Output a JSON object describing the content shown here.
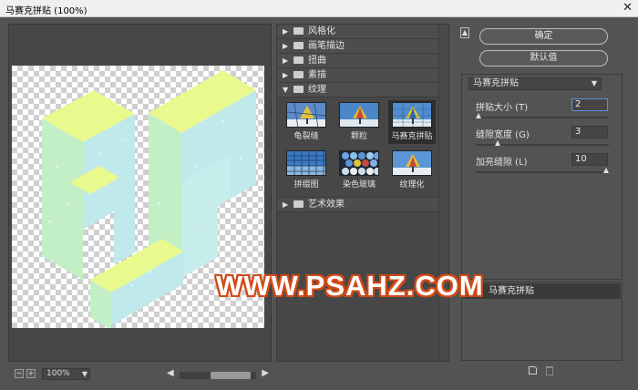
{
  "window": {
    "title": "马赛克拼贴 (100%)",
    "close_glyph": "✕"
  },
  "preview": {
    "zoom_value": "100%",
    "zoom_minus": "−",
    "zoom_plus": "+"
  },
  "gallery": {
    "categories": [
      {
        "label": "风格化",
        "expanded": false
      },
      {
        "label": "画笔描边",
        "expanded": false
      },
      {
        "label": "扭曲",
        "expanded": false
      },
      {
        "label": "素描",
        "expanded": false
      },
      {
        "label": "纹理",
        "expanded": true
      },
      {
        "label": "艺术效果",
        "expanded": false
      }
    ],
    "texture_thumbs": [
      {
        "label": "龟裂缝",
        "icon": "craquelure-thumbnail"
      },
      {
        "label": "颗粒",
        "icon": "grain-thumbnail"
      },
      {
        "label": "马赛克拼贴",
        "icon": "mosaic-tiles-thumbnail",
        "selected": true
      },
      {
        "label": "拼缀图",
        "icon": "patchwork-thumbnail"
      },
      {
        "label": "染色玻璃",
        "icon": "stained-glass-thumbnail"
      },
      {
        "label": "纹理化",
        "icon": "texturizer-thumbnail"
      }
    ]
  },
  "actions": {
    "ok_label": "确定",
    "default_label": "默认值"
  },
  "settings": {
    "filter_name": "马赛克拼贴",
    "params": [
      {
        "label": "拼贴大小 (T)",
        "value": "2",
        "level": 0.0
      },
      {
        "label": "缝隙宽度 (G)",
        "value": "3",
        "level": 0.15
      },
      {
        "label": "加亮缝隙 (L)",
        "value": "10",
        "level": 1.0
      }
    ]
  },
  "layers": {
    "active_layer": "马赛克拼贴"
  },
  "watermark": "WWW.PSAHZ.COM",
  "colors": {
    "face_top": "#e9f98e",
    "face_left": "#bff0c4",
    "face_right": "#bfe9ea",
    "watermark_outline": "#d24a16"
  }
}
